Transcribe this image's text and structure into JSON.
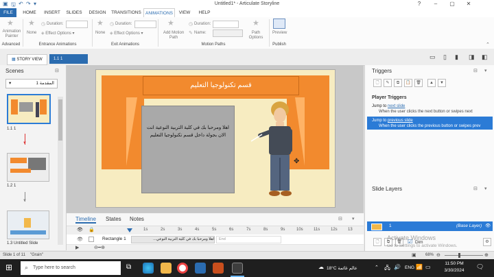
{
  "window": {
    "title": "Untitled1* - Articulate Storyline"
  },
  "ribbon": {
    "tabs": [
      "FILE",
      "HOME",
      "INSERT",
      "SLIDES",
      "DESIGN",
      "TRANSITIONS",
      "ANIMATIONS",
      "VIEW",
      "HELP"
    ],
    "active_tab": "ANIMATIONS",
    "animation_painter": "Animation Painter",
    "advanced_group": "Advanced",
    "entrance": {
      "none_label": "None",
      "effect_options": "Effect Options",
      "duration_label": "Duration:",
      "group": "Entrance Animations"
    },
    "exit": {
      "none_label": "None",
      "effect_options": "Effect Options",
      "duration_label": "Duration:",
      "group": "Exit Animations"
    },
    "motion": {
      "add_motion_path": "Add Motion Path",
      "duration_label": "Duration:",
      "name_label": "Name:",
      "path_options": "Path Options",
      "group": "Motion Paths"
    },
    "preview": {
      "label": "Preview",
      "group": "Publish"
    }
  },
  "doc_tabs": {
    "story_view": "STORY VIEW",
    "slide_tab": "1.1 1"
  },
  "scenes": {
    "title": "Scenes",
    "dropdown_value": "المقدمة 1",
    "slides": [
      {
        "label": "1.1 1"
      },
      {
        "label": "1.2 1"
      },
      {
        "label": "1.3 Untitled Slide"
      }
    ]
  },
  "slide": {
    "banner_text": "قسم تكنولوجيا التعليم",
    "body_text": "اهلا ومرحبا بك في كلية التربية النوعية انت الان بجولة داخل قسم تكنولوجيا التعليم"
  },
  "timeline": {
    "tabs": [
      "Timeline",
      "States",
      "Notes"
    ],
    "active_tab": "Timeline",
    "ticks": [
      "1s",
      "2s",
      "3s",
      "4s",
      "5s",
      "6s",
      "7s",
      "8s",
      "9s",
      "10s",
      "11s",
      "12s",
      "13"
    ],
    "row_name": "Rectangle 1",
    "row_clip_text": "اهلا ومرحبا بك في كلية التربية النوعي...",
    "end_label": "End"
  },
  "triggers": {
    "title": "Triggers",
    "section": "Player Triggers",
    "items": [
      {
        "prefix": "Jump to",
        "link": "next slide",
        "desc": "When the user clicks the next button or swipes next",
        "selected": false
      },
      {
        "prefix": "Jump to",
        "link": "previous slide",
        "desc": "When the user clicks the previous button or swipes prev",
        "selected": true
      }
    ]
  },
  "layers": {
    "title": "Slide Layers",
    "base_label": "1",
    "base_tag": "(Base Layer)",
    "dim_label": "Dim"
  },
  "watermark": {
    "line1": "Activate Windows",
    "line2": "Go to Settings to activate Windows."
  },
  "status": {
    "slide_info": "Slide 1 of 11",
    "theme": "\"Grain\"",
    "zoom": "68%"
  },
  "taskbar": {
    "search_placeholder": "Type here to search",
    "weather": "18°C  عالم غائمة",
    "language": "ENG",
    "time": "11:50 PM",
    "date": "3/30/2024"
  },
  "colors": {
    "accent": "#2b6cb0",
    "selection": "#2b7bd6",
    "slide_bg": "#f7ecc1",
    "slide_orange": "#f28a2e"
  }
}
